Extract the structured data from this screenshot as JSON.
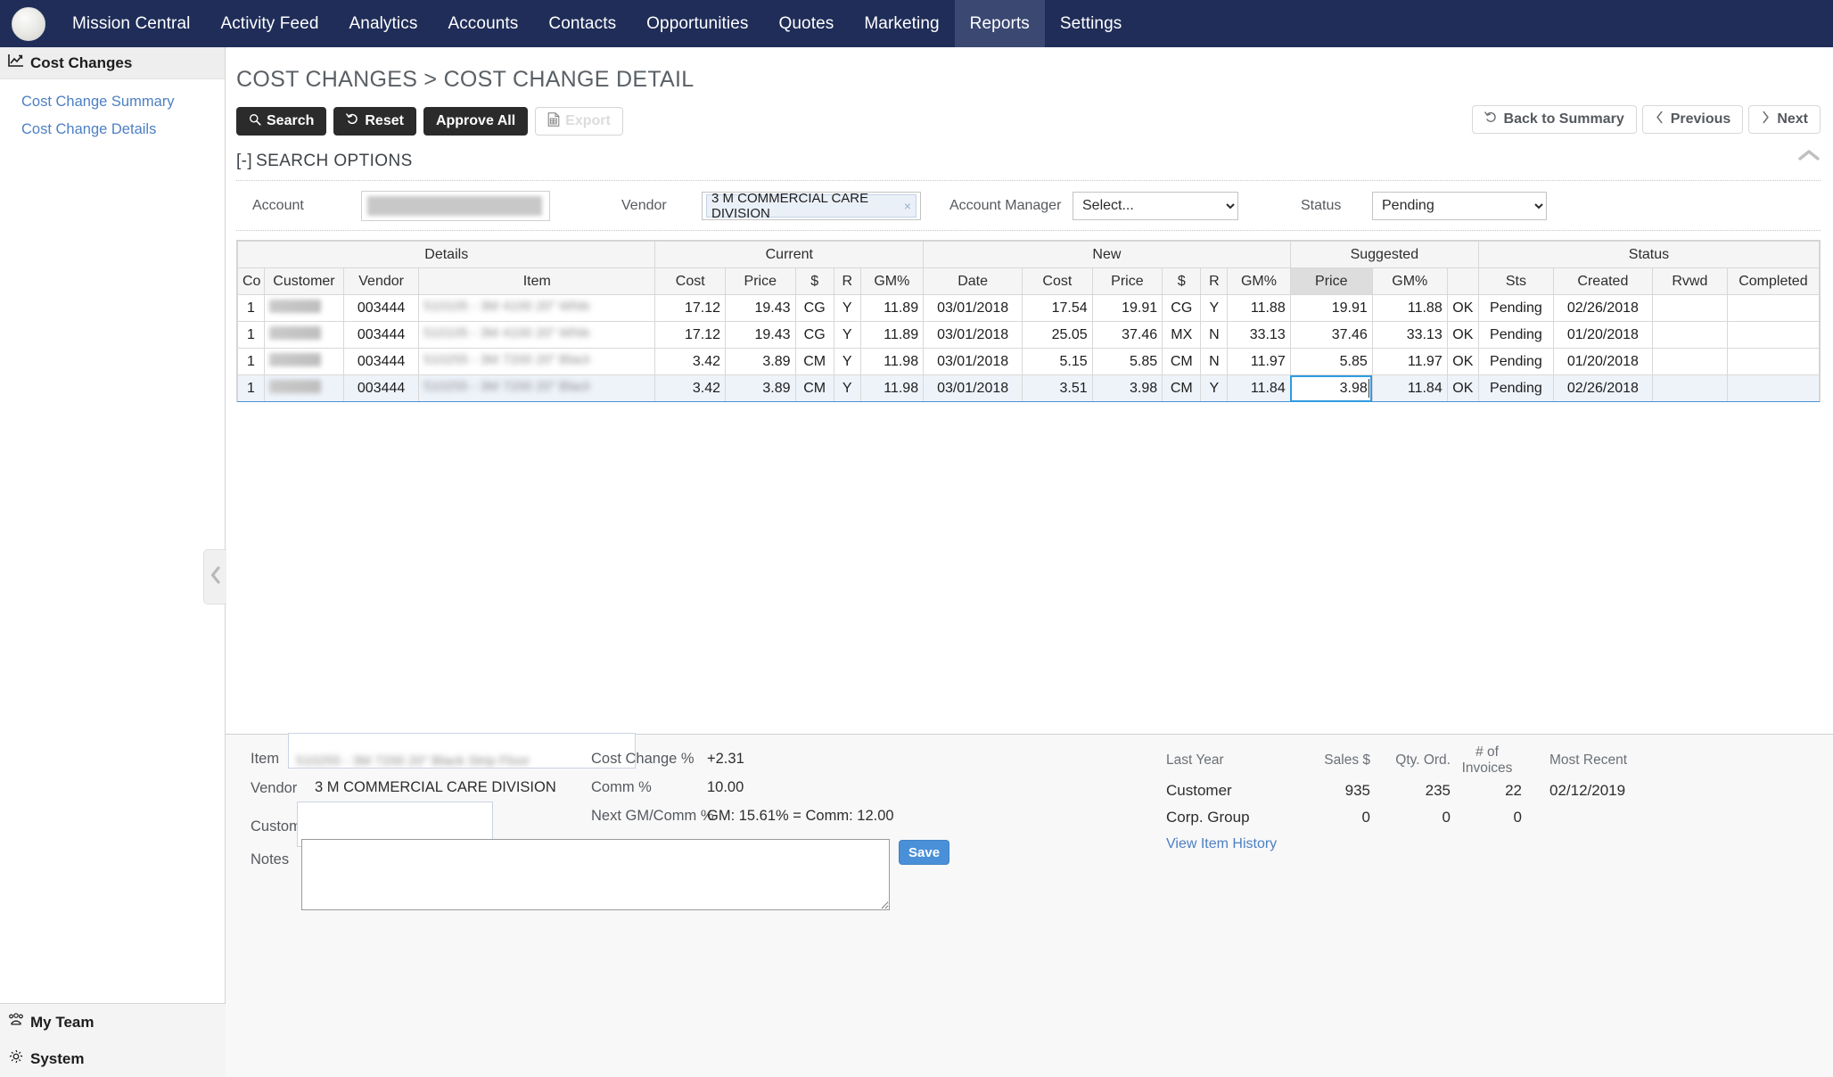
{
  "nav": {
    "items": [
      {
        "label": "Mission Central",
        "active": false
      },
      {
        "label": "Activity Feed",
        "active": false
      },
      {
        "label": "Analytics",
        "active": false
      },
      {
        "label": "Accounts",
        "active": false
      },
      {
        "label": "Contacts",
        "active": false
      },
      {
        "label": "Opportunities",
        "active": false
      },
      {
        "label": "Quotes",
        "active": false
      },
      {
        "label": "Marketing",
        "active": false
      },
      {
        "label": "Reports",
        "active": true
      },
      {
        "label": "Settings",
        "active": false
      }
    ]
  },
  "sidebar": {
    "header": "Cost Changes",
    "header_icon": "line-chart-icon",
    "links": [
      {
        "label": "Cost Change Summary"
      },
      {
        "label": "Cost Change Details"
      }
    ],
    "bottom": [
      {
        "label": "My Team",
        "icon": "people-icon"
      },
      {
        "label": "System",
        "icon": "gear-icon"
      }
    ],
    "collapse_icon": "chevron-left-icon"
  },
  "page": {
    "title": "COST CHANGES > COST CHANGE DETAIL"
  },
  "toolbar": {
    "search_label": "Search",
    "reset_label": "Reset",
    "approve_all_label": "Approve All",
    "export_label": "Export",
    "back_to_summary_label": "Back to Summary",
    "previous_label": "Previous",
    "next_label": "Next"
  },
  "search_options": {
    "title": "SEARCH OPTIONS",
    "toggle_bracket": "[-]",
    "collapse_icon": "chevron-up-icon",
    "account_label": "Account",
    "account_value": "",
    "vendor_label": "Vendor",
    "vendor_tag": "3 M COMMERCIAL CARE DIVISION",
    "vendor_tag_remove": "×",
    "account_manager_label": "Account Manager",
    "account_manager_value": "Select...",
    "account_manager_options": [
      "Select..."
    ],
    "status_label": "Status",
    "status_value": "Pending",
    "status_options": [
      "Pending"
    ]
  },
  "grid": {
    "group_headers": [
      {
        "label": "Details",
        "span": 4
      },
      {
        "label": "Current",
        "span": 5
      },
      {
        "label": "New",
        "span": 6
      },
      {
        "label": "Suggested",
        "span": 3
      },
      {
        "label": "Status",
        "span": 4
      }
    ],
    "columns": [
      {
        "label": "Co"
      },
      {
        "label": "Customer"
      },
      {
        "label": "Vendor"
      },
      {
        "label": "Item"
      },
      {
        "label": "Cost"
      },
      {
        "label": "Price"
      },
      {
        "label": "$"
      },
      {
        "label": "R"
      },
      {
        "label": "GM%"
      },
      {
        "label": "Date"
      },
      {
        "label": "Cost"
      },
      {
        "label": "Price"
      },
      {
        "label": "$"
      },
      {
        "label": "R"
      },
      {
        "label": "GM%"
      },
      {
        "label": "Price",
        "sorted": true
      },
      {
        "label": "GM%"
      },
      {
        "label": ""
      },
      {
        "label": "Sts"
      },
      {
        "label": "Created"
      },
      {
        "label": "Rvwd"
      },
      {
        "label": "Completed"
      }
    ],
    "rows": [
      {
        "co": "1",
        "customer": "1000202",
        "customer_redacted": true,
        "vendor": "003444",
        "item": "510105 - 3M 4100 20\" White Polish Floor ...",
        "item_redacted": true,
        "cur_cost": "17.12",
        "cur_price": "19.43",
        "cur_dollar": "CG",
        "cur_r": "Y",
        "cur_gm": "11.89",
        "new_date": "03/01/2018",
        "new_cost": "17.54",
        "new_price": "19.91",
        "new_dollar": "CG",
        "new_r": "Y",
        "new_gm": "11.88",
        "sug_price": "19.91",
        "sug_gm": "11.88",
        "ok": "OK",
        "sts": "Pending",
        "created": "02/26/2018",
        "rvwd": "",
        "completed": "",
        "selected": false,
        "editing": false
      },
      {
        "co": "1",
        "customer": "1000202",
        "customer_redacted": true,
        "vendor": "003444",
        "item": "510105 - 3M 4100 20\" White Polish Floor ...",
        "item_redacted": true,
        "cur_cost": "17.12",
        "cur_price": "19.43",
        "cur_dollar": "CG",
        "cur_r": "Y",
        "cur_gm": "11.89",
        "new_date": "03/01/2018",
        "new_cost": "25.05",
        "new_price": "37.46",
        "new_dollar": "MX",
        "new_r": "N",
        "new_gm": "33.13",
        "sug_price": "37.46",
        "sug_gm": "33.13",
        "ok": "OK",
        "sts": "Pending",
        "created": "01/20/2018",
        "rvwd": "",
        "completed": "",
        "selected": false,
        "editing": false
      },
      {
        "co": "1",
        "customer": "1000202",
        "customer_redacted": true,
        "vendor": "003444",
        "item": "510255 - 3M 7200 20\" Black Strip Floor ...",
        "item_redacted": true,
        "cur_cost": "3.42",
        "cur_price": "3.89",
        "cur_dollar": "CM",
        "cur_r": "Y",
        "cur_gm": "11.98",
        "new_date": "03/01/2018",
        "new_cost": "5.15",
        "new_price": "5.85",
        "new_dollar": "CM",
        "new_r": "N",
        "new_gm": "11.97",
        "sug_price": "5.85",
        "sug_gm": "11.97",
        "ok": "OK",
        "sts": "Pending",
        "created": "01/20/2018",
        "rvwd": "",
        "completed": "",
        "selected": false,
        "editing": false
      },
      {
        "co": "1",
        "customer": "1000202",
        "customer_redacted": true,
        "vendor": "003444",
        "item": "510255 - 3M 7200 20\" Black Strip Floor ...",
        "item_redacted": true,
        "cur_cost": "3.42",
        "cur_price": "3.89",
        "cur_dollar": "CM",
        "cur_r": "Y",
        "cur_gm": "11.98",
        "new_date": "03/01/2018",
        "new_cost": "3.51",
        "new_price": "3.98",
        "new_dollar": "CM",
        "new_r": "Y",
        "new_gm": "11.84",
        "sug_price": "3.98",
        "sug_gm": "11.84",
        "ok": "OK",
        "sts": "Pending",
        "created": "02/26/2018",
        "rvwd": "",
        "completed": "",
        "selected": true,
        "editing": true
      }
    ]
  },
  "detail": {
    "item_label": "Item",
    "item_value": "",
    "vendor_label": "Vendor",
    "vendor_value": "3 M COMMERCIAL CARE DIVISION",
    "customer_label": "Customer",
    "customer_value": "",
    "notes_label": "Notes",
    "notes_value": "",
    "save_label": "Save",
    "cost_change_label": "Cost Change %",
    "cost_change_value": "+2.31",
    "comm_label": "Comm %",
    "comm_value": "10.00",
    "next_gm_label": "Next GM/Comm %",
    "next_gm_value": "GM: 15.61% = Comm: 12.00"
  },
  "stats": {
    "col_headers": [
      "Last Year",
      "Sales $",
      "Qty. Ord.",
      "# of Invoices",
      "Most Recent"
    ],
    "rows": [
      {
        "label": "Customer",
        "sales": "935",
        "qty": "235",
        "invoices": "22",
        "most_recent": "02/12/2019"
      },
      {
        "label": "Corp. Group",
        "sales": "0",
        "qty": "0",
        "invoices": "0",
        "most_recent": ""
      }
    ],
    "link_label": "View Item History"
  },
  "colors": {
    "nav_bg": "#1f2d58",
    "nav_active_bg": "#3a4872",
    "link": "#4c7fc4",
    "green": "#2f7d32",
    "accent": "#4a90d9"
  }
}
